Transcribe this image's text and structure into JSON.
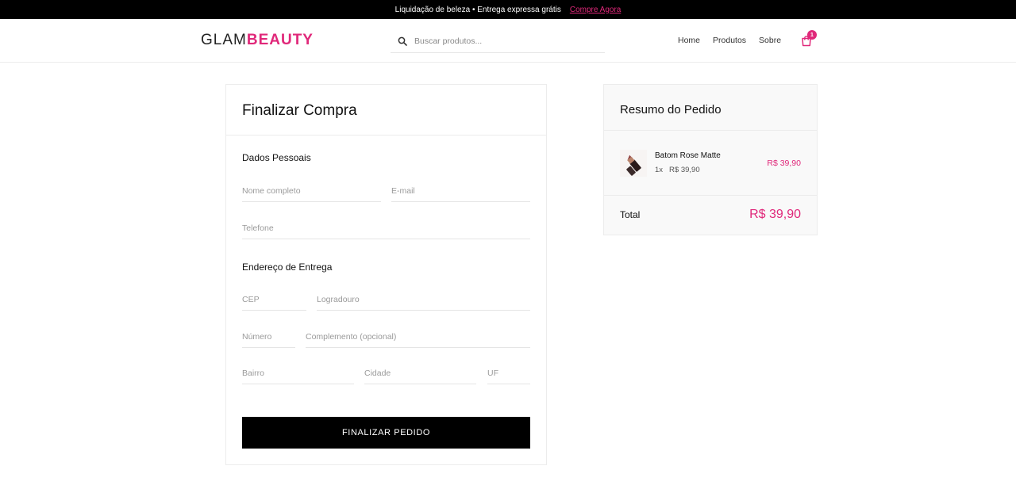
{
  "promo": {
    "text": "Liquidação de beleza • Entrega expressa grátis",
    "link": "Compre Agora"
  },
  "header": {
    "logo_part1": "GLAM",
    "logo_part2": "BEAUTY",
    "search_placeholder": "Buscar produtos...",
    "nav": [
      "Home",
      "Produtos",
      "Sobre"
    ],
    "cart_count": "1"
  },
  "checkout": {
    "title": "Finalizar Compra",
    "personal_section": "Dados Pessoais",
    "placeholders": {
      "name": "Nome completo",
      "email": "E-mail",
      "phone": "Telefone",
      "cep": "CEP",
      "street": "Logradouro",
      "number": "Número",
      "complement": "Complemento (opcional)",
      "district": "Bairro",
      "city": "Cidade",
      "state": "UF"
    },
    "address_section": "Endereço de Entrega",
    "submit_label": "FINALIZAR PEDIDO"
  },
  "summary": {
    "title": "Resumo do Pedido",
    "items": [
      {
        "name": "Batom Rose Matte",
        "qty": "1x",
        "unit_price": "R$ 39,90",
        "line_total": "R$ 39,90"
      }
    ],
    "total_label": "Total",
    "total_value": "R$ 39,90"
  },
  "colors": {
    "accent": "#e0287a",
    "promo_bg": "#000000",
    "button_bg": "#000000"
  }
}
